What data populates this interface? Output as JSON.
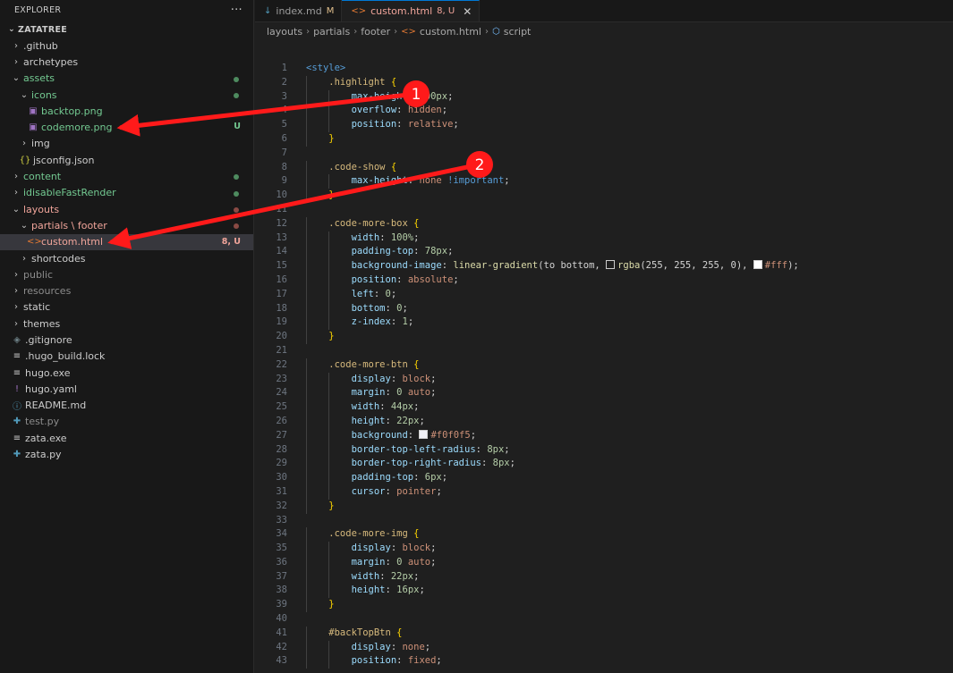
{
  "explorer": {
    "title": "EXPLORER",
    "more": "···",
    "root": "ZATATREE",
    "items": [
      {
        "label": "github",
        "kind": "folder",
        "depth": 0,
        "expanded": false,
        "color": "#cccccc",
        "prefix": "."
      },
      {
        "label": "archetypes",
        "kind": "folder",
        "depth": 0,
        "expanded": false,
        "color": "#cccccc"
      },
      {
        "label": "assets",
        "kind": "folder",
        "depth": 0,
        "expanded": true,
        "color": "#73c991",
        "dot": "#4e8b5f"
      },
      {
        "label": "icons",
        "kind": "folder",
        "depth": 1,
        "expanded": true,
        "color": "#73c991",
        "dot": "#4e8b5f"
      },
      {
        "label": "backtop.png",
        "kind": "image",
        "depth": 2,
        "color": "#73c991"
      },
      {
        "label": "codemore.png",
        "kind": "image",
        "depth": 2,
        "color": "#73c991",
        "badge": "U",
        "badge_color": "#73c991"
      },
      {
        "label": "img",
        "kind": "folder",
        "depth": 1,
        "expanded": false,
        "color": "#cccccc"
      },
      {
        "label": "jsconfig.json",
        "kind": "json",
        "depth": 1,
        "color": "#cccccc"
      },
      {
        "label": "content",
        "kind": "folder",
        "depth": 0,
        "expanded": false,
        "color": "#73c991",
        "dot": "#4e8b5f"
      },
      {
        "label": "idisableFastRender",
        "kind": "folder",
        "depth": 0,
        "expanded": false,
        "color": "#73c991",
        "dot": "#4e8b5f"
      },
      {
        "label": "layouts",
        "kind": "folder",
        "depth": 0,
        "expanded": true,
        "color": "#f0a49a",
        "dot": "#8a4a44"
      },
      {
        "label": "partials \\ footer",
        "kind": "folder",
        "depth": 1,
        "expanded": true,
        "color": "#f0a49a",
        "dot": "#8a4a44"
      },
      {
        "label": "custom.html",
        "kind": "html",
        "depth": 2,
        "color": "#f0a49a",
        "badge": "8, U",
        "badge_color": "#f0a49a",
        "selected": true
      },
      {
        "label": "shortcodes",
        "kind": "folder",
        "depth": 1,
        "expanded": false,
        "color": "#cccccc"
      },
      {
        "label": "public",
        "kind": "folder",
        "depth": 0,
        "expanded": false,
        "color": "#8c8c8c"
      },
      {
        "label": "resources",
        "kind": "folder",
        "depth": 0,
        "expanded": false,
        "color": "#8c8c8c"
      },
      {
        "label": "static",
        "kind": "folder",
        "depth": 0,
        "expanded": false,
        "color": "#cccccc"
      },
      {
        "label": "themes",
        "kind": "folder",
        "depth": 0,
        "expanded": false,
        "color": "#cccccc"
      },
      {
        "label": ".gitignore",
        "kind": "git",
        "depth": 0,
        "color": "#cccccc"
      },
      {
        "label": ".hugo_build.lock",
        "kind": "lock",
        "depth": 0,
        "color": "#cccccc"
      },
      {
        "label": "hugo.exe",
        "kind": "exe",
        "depth": 0,
        "color": "#cccccc"
      },
      {
        "label": "hugo.yaml",
        "kind": "yaml",
        "depth": 0,
        "color": "#cccccc"
      },
      {
        "label": "README.md",
        "kind": "info",
        "depth": 0,
        "color": "#cccccc"
      },
      {
        "label": "test.py",
        "kind": "python",
        "depth": 0,
        "color": "#8c8c8c"
      },
      {
        "label": "zata.exe",
        "kind": "exe",
        "depth": 0,
        "color": "#cccccc"
      },
      {
        "label": "zata.py",
        "kind": "python",
        "depth": 0,
        "color": "#cccccc"
      }
    ]
  },
  "tabs": [
    {
      "label": "index.md",
      "state": "M",
      "icon": "↓",
      "icon_color": "#519aba",
      "active": false
    },
    {
      "label": "custom.html",
      "state": "8, U",
      "icon": "<>",
      "icon_color": "#e37933",
      "active": true,
      "close": "✕"
    }
  ],
  "breadcrumb": [
    "layouts",
    "partials",
    "footer",
    "custom.html",
    "script"
  ],
  "code": [
    {
      "n": "1",
      "t": [
        [
          "<style>",
          "tag"
        ]
      ]
    },
    {
      "n": "2",
      "t": [
        [
          "    .highlight ",
          "sel"
        ],
        [
          "{",
          "brace"
        ]
      ]
    },
    {
      "n": "3",
      "t": [
        [
          "        max-height",
          "prop"
        ],
        [
          ": ",
          "pun"
        ],
        [
          "400px",
          "num"
        ],
        [
          ";",
          "pun"
        ]
      ]
    },
    {
      "n": "4",
      "t": [
        [
          "        overflow",
          "prop"
        ],
        [
          ": ",
          "pun"
        ],
        [
          "hidden",
          "val"
        ],
        [
          ";",
          "pun"
        ]
      ]
    },
    {
      "n": "5",
      "t": [
        [
          "        position",
          "prop"
        ],
        [
          ": ",
          "pun"
        ],
        [
          "relative",
          "val"
        ],
        [
          ";",
          "pun"
        ]
      ]
    },
    {
      "n": "6",
      "t": [
        [
          "    }",
          "brace"
        ]
      ]
    },
    {
      "n": "7",
      "t": []
    },
    {
      "n": "8",
      "t": [
        [
          "    .code-show ",
          "sel"
        ],
        [
          "{",
          "brace"
        ]
      ]
    },
    {
      "n": "9",
      "t": [
        [
          "        max-height",
          "prop"
        ],
        [
          ": ",
          "pun"
        ],
        [
          "none ",
          "val"
        ],
        [
          "!important",
          "imp"
        ],
        [
          ";",
          "pun"
        ]
      ]
    },
    {
      "n": "10",
      "t": [
        [
          "    }",
          "brace"
        ]
      ]
    },
    {
      "n": "11",
      "t": []
    },
    {
      "n": "12",
      "t": [
        [
          "    .code-more-box ",
          "sel"
        ],
        [
          "{",
          "brace"
        ]
      ]
    },
    {
      "n": "13",
      "t": [
        [
          "        width",
          "prop"
        ],
        [
          ": ",
          "pun"
        ],
        [
          "100%",
          "num"
        ],
        [
          ";",
          "pun"
        ]
      ]
    },
    {
      "n": "14",
      "t": [
        [
          "        padding-top",
          "prop"
        ],
        [
          ": ",
          "pun"
        ],
        [
          "78px",
          "num"
        ],
        [
          ";",
          "pun"
        ]
      ]
    },
    {
      "n": "15",
      "t": [
        [
          "        background-image",
          "prop"
        ],
        [
          ": ",
          "pun"
        ],
        [
          "linear-gradient",
          "fn"
        ],
        [
          "(to bottom, ",
          "pun"
        ],
        [
          "",
          "swatch:#1f1f1f"
        ],
        [
          "rgba",
          "fn"
        ],
        [
          "(255, 255, 255, 0), ",
          "pun"
        ],
        [
          "",
          "swatch:#ffffff"
        ],
        [
          "#fff",
          "val"
        ],
        [
          ");",
          "pun"
        ]
      ]
    },
    {
      "n": "16",
      "t": [
        [
          "        position",
          "prop"
        ],
        [
          ": ",
          "pun"
        ],
        [
          "absolute",
          "val"
        ],
        [
          ";",
          "pun"
        ]
      ]
    },
    {
      "n": "17",
      "t": [
        [
          "        left",
          "prop"
        ],
        [
          ": ",
          "pun"
        ],
        [
          "0",
          "num"
        ],
        [
          ";",
          "pun"
        ]
      ]
    },
    {
      "n": "18",
      "t": [
        [
          "        bottom",
          "prop"
        ],
        [
          ": ",
          "pun"
        ],
        [
          "0",
          "num"
        ],
        [
          ";",
          "pun"
        ]
      ]
    },
    {
      "n": "19",
      "t": [
        [
          "        z-index",
          "prop"
        ],
        [
          ": ",
          "pun"
        ],
        [
          "1",
          "num"
        ],
        [
          ";",
          "pun"
        ]
      ]
    },
    {
      "n": "20",
      "t": [
        [
          "    }",
          "brace"
        ]
      ]
    },
    {
      "n": "21",
      "t": []
    },
    {
      "n": "22",
      "t": [
        [
          "    .code-more-btn ",
          "sel"
        ],
        [
          "{",
          "brace"
        ]
      ]
    },
    {
      "n": "23",
      "t": [
        [
          "        display",
          "prop"
        ],
        [
          ": ",
          "pun"
        ],
        [
          "block",
          "val"
        ],
        [
          ";",
          "pun"
        ]
      ]
    },
    {
      "n": "24",
      "t": [
        [
          "        margin",
          "prop"
        ],
        [
          ": ",
          "pun"
        ],
        [
          "0 ",
          "num"
        ],
        [
          "auto",
          "val"
        ],
        [
          ";",
          "pun"
        ]
      ]
    },
    {
      "n": "25",
      "t": [
        [
          "        width",
          "prop"
        ],
        [
          ": ",
          "pun"
        ],
        [
          "44px",
          "num"
        ],
        [
          ";",
          "pun"
        ]
      ]
    },
    {
      "n": "26",
      "t": [
        [
          "        height",
          "prop"
        ],
        [
          ": ",
          "pun"
        ],
        [
          "22px",
          "num"
        ],
        [
          ";",
          "pun"
        ]
      ]
    },
    {
      "n": "27",
      "t": [
        [
          "        background",
          "prop"
        ],
        [
          ": ",
          "pun"
        ],
        [
          "",
          "swatch:#f0f0f5"
        ],
        [
          "#f0f0f5",
          "val"
        ],
        [
          ";",
          "pun"
        ]
      ]
    },
    {
      "n": "28",
      "t": [
        [
          "        border-top-left-radius",
          "prop"
        ],
        [
          ": ",
          "pun"
        ],
        [
          "8px",
          "num"
        ],
        [
          ";",
          "pun"
        ]
      ]
    },
    {
      "n": "29",
      "t": [
        [
          "        border-top-right-radius",
          "prop"
        ],
        [
          ": ",
          "pun"
        ],
        [
          "8px",
          "num"
        ],
        [
          ";",
          "pun"
        ]
      ]
    },
    {
      "n": "30",
      "t": [
        [
          "        padding-top",
          "prop"
        ],
        [
          ": ",
          "pun"
        ],
        [
          "6px",
          "num"
        ],
        [
          ";",
          "pun"
        ]
      ]
    },
    {
      "n": "31",
      "t": [
        [
          "        cursor",
          "prop"
        ],
        [
          ": ",
          "pun"
        ],
        [
          "pointer",
          "val"
        ],
        [
          ";",
          "pun"
        ]
      ]
    },
    {
      "n": "32",
      "t": [
        [
          "    }",
          "brace"
        ]
      ]
    },
    {
      "n": "33",
      "t": []
    },
    {
      "n": "34",
      "t": [
        [
          "    .code-more-img ",
          "sel"
        ],
        [
          "{",
          "brace"
        ]
      ]
    },
    {
      "n": "35",
      "t": [
        [
          "        display",
          "prop"
        ],
        [
          ": ",
          "pun"
        ],
        [
          "block",
          "val"
        ],
        [
          ";",
          "pun"
        ]
      ]
    },
    {
      "n": "36",
      "t": [
        [
          "        margin",
          "prop"
        ],
        [
          ": ",
          "pun"
        ],
        [
          "0 ",
          "num"
        ],
        [
          "auto",
          "val"
        ],
        [
          ";",
          "pun"
        ]
      ]
    },
    {
      "n": "37",
      "t": [
        [
          "        width",
          "prop"
        ],
        [
          ": ",
          "pun"
        ],
        [
          "22px",
          "num"
        ],
        [
          ";",
          "pun"
        ]
      ]
    },
    {
      "n": "38",
      "t": [
        [
          "        height",
          "prop"
        ],
        [
          ": ",
          "pun"
        ],
        [
          "16px",
          "num"
        ],
        [
          ";",
          "pun"
        ]
      ]
    },
    {
      "n": "39",
      "t": [
        [
          "    }",
          "brace"
        ]
      ]
    },
    {
      "n": "40",
      "t": []
    },
    {
      "n": "41",
      "t": [
        [
          "    #backTopBtn ",
          "sel"
        ],
        [
          "{",
          "brace"
        ]
      ]
    },
    {
      "n": "42",
      "t": [
        [
          "        display",
          "prop"
        ],
        [
          ": ",
          "pun"
        ],
        [
          "none",
          "val"
        ],
        [
          ";",
          "pun"
        ]
      ]
    },
    {
      "n": "43",
      "t": [
        [
          "        position",
          "prop"
        ],
        [
          ": ",
          "pun"
        ],
        [
          "fixed",
          "val"
        ],
        [
          ";",
          "pun"
        ]
      ]
    }
  ],
  "annotations": [
    {
      "label": "1",
      "target": "codemore.png"
    },
    {
      "label": "2",
      "target": "custom.html"
    }
  ],
  "colors": {
    "arrow": "#ff1a1a",
    "accent": "#0078d4"
  }
}
